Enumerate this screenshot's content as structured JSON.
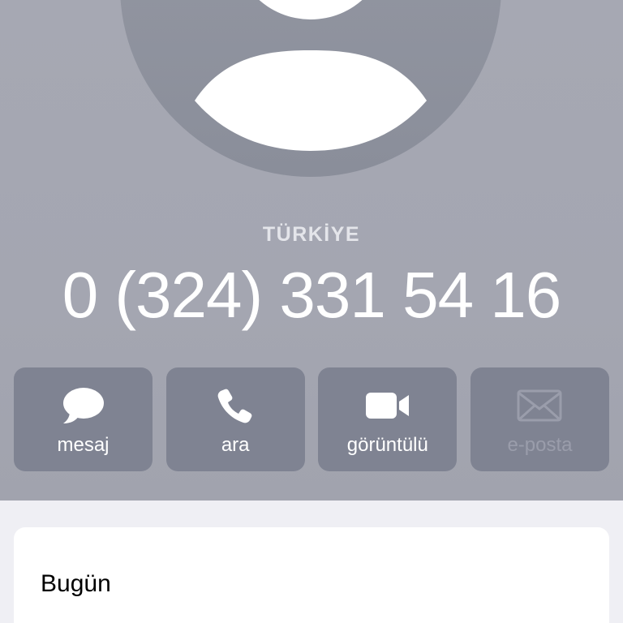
{
  "contact": {
    "country": "TÜRKİYE",
    "phone": "0 (324) 331 54 16"
  },
  "actions": [
    {
      "label": "mesaj",
      "icon": "message-bubble-icon",
      "enabled": true
    },
    {
      "label": "ara",
      "icon": "phone-icon",
      "enabled": true
    },
    {
      "label": "görüntülü",
      "icon": "video-camera-icon",
      "enabled": true
    },
    {
      "label": "e-posta",
      "icon": "envelope-icon",
      "enabled": false
    }
  ],
  "history": {
    "title": "Bugün"
  },
  "colors": {
    "header_bg": "#a6a8b3",
    "avatar_bg": "#8e919d",
    "button_bg": "#7f8392",
    "disabled_text": "#9a9dab",
    "page_bg": "#efeff4"
  }
}
